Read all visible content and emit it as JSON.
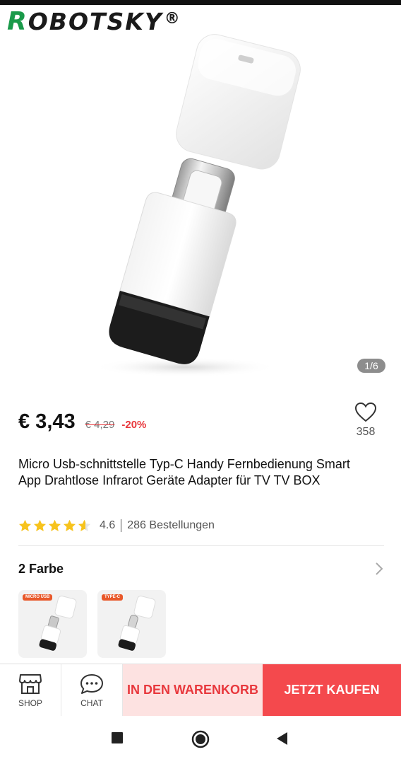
{
  "brand": {
    "logo_text": "Robotsky",
    "logo_first": "R",
    "logo_rest": "OBOTSKY",
    "registered_mark": "®"
  },
  "gallery": {
    "page_indicator": "1/6"
  },
  "product": {
    "price_current": "€ 3,43",
    "price_original": "€ 4,29",
    "discount": "-20%",
    "wishlist_count": "358",
    "title": "Micro Usb-schnittstelle Typ-C Handy Fernbedienung Smart App Drahtlose Infrarot Geräte Adapter für TV TV BOX",
    "rating": "4.6",
    "rating_stars": 4.6,
    "orders": "286 Bestellungen"
  },
  "variants": {
    "label": "2 Farbe",
    "options": [
      {
        "tag": "MICRO USB"
      },
      {
        "tag": "TYPE-C"
      }
    ]
  },
  "action_bar": {
    "shop_label": "SHOP",
    "chat_label": "CHAT",
    "cart_label": "IN DEN WARENKORB",
    "buy_label": "JETZT KAUFEN"
  },
  "colors": {
    "accent_red": "#f4494d",
    "light_red": "#fde2e1",
    "star_yellow": "#f7c31c",
    "brand_green": "#1a9a4a"
  },
  "icons": {
    "wishlist": "heart-icon",
    "chevron": "chevron-right-icon",
    "shop": "store-icon",
    "chat": "chat-bubble-icon",
    "nav_recents": "square-icon",
    "nav_home": "circle-icon",
    "nav_back": "triangle-back-icon"
  }
}
